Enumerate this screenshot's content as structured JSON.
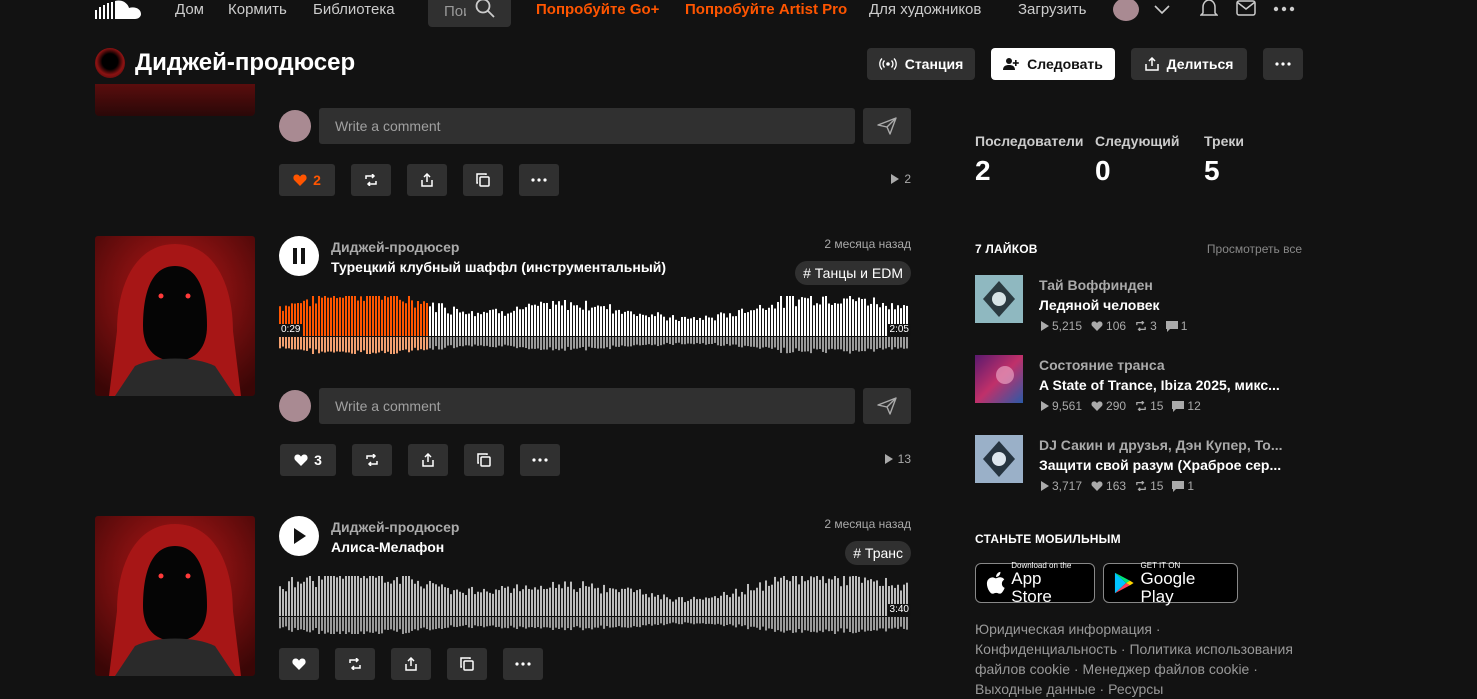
{
  "nav": {
    "home": "Дом",
    "feed": "Кормить",
    "library": "Библиотека",
    "search_value": "Пои",
    "try_go": "Попробуйте Go+",
    "try_artist": "Попробуйте Artist Pro",
    "for_artists": "Для художников",
    "upload": "Загрузить"
  },
  "header": {
    "title": "Диджей-продюсер",
    "station": "Станция",
    "follow": "Следовать",
    "share": "Делиться"
  },
  "comment_placeholder": "Write a comment",
  "partial_track": {
    "likes": "2",
    "plays": "2"
  },
  "tracks": [
    {
      "artist": "Диджей-продюсер",
      "title": "Турецкий клубный шаффл (инструментальный)",
      "date": "2 месяца назад",
      "tag": "# Танцы и EDM",
      "elapsed": "0:29",
      "duration": "2:05",
      "progress": 0.235,
      "playing": true,
      "likes": "3",
      "plays": "13"
    },
    {
      "artist": "Диджей-продюсер",
      "title": "Алиса-Мелафон",
      "date": "2 месяца назад",
      "tag": "# Транс",
      "duration": "3:40",
      "progress": 0,
      "playing": false
    }
  ],
  "stats": {
    "followers_label": "Последователи",
    "followers": "2",
    "following_label": "Следующий",
    "following": "0",
    "tracks_label": "Треки",
    "tracks": "5"
  },
  "likes_section": {
    "heading": "7 ЛАЙКОВ",
    "view_all": "Просмотреть все",
    "items": [
      {
        "artist": "Тай Воффинден",
        "title": "Ледяной человек",
        "plays": "5,215",
        "likes": "106",
        "reposts": "3",
        "comments": "1"
      },
      {
        "artist": "Состояние транса",
        "title": "A State of Trance, Ibiza 2025, микс...",
        "plays": "9,561",
        "likes": "290",
        "reposts": "15",
        "comments": "12"
      },
      {
        "artist": "DJ Сакин и друзья, Дэн Купер, То...",
        "title": "Защити свой разум (Храброе сер...",
        "plays": "3,717",
        "likes": "163",
        "reposts": "15",
        "comments": "1"
      }
    ]
  },
  "mobile": {
    "heading": "СТАНЬТЕ МОБИЛЬНЫМ",
    "appstore_small": "Download on the",
    "appstore_big": "App Store",
    "gplay_small": "GET IT ON",
    "gplay_big": "Google Play"
  },
  "footer": {
    "legal": "Юридическая информация",
    "privacy": "Конфиденциальность",
    "cookie_policy": "Политика использования файлов cookie",
    "cookie_manager": "Менеджер файлов cookie",
    "imprint": "Выходные данные",
    "resources": "Ресурсы"
  },
  "colors": {
    "accent": "#ff5500",
    "background": "#121212",
    "surface": "#303030"
  }
}
